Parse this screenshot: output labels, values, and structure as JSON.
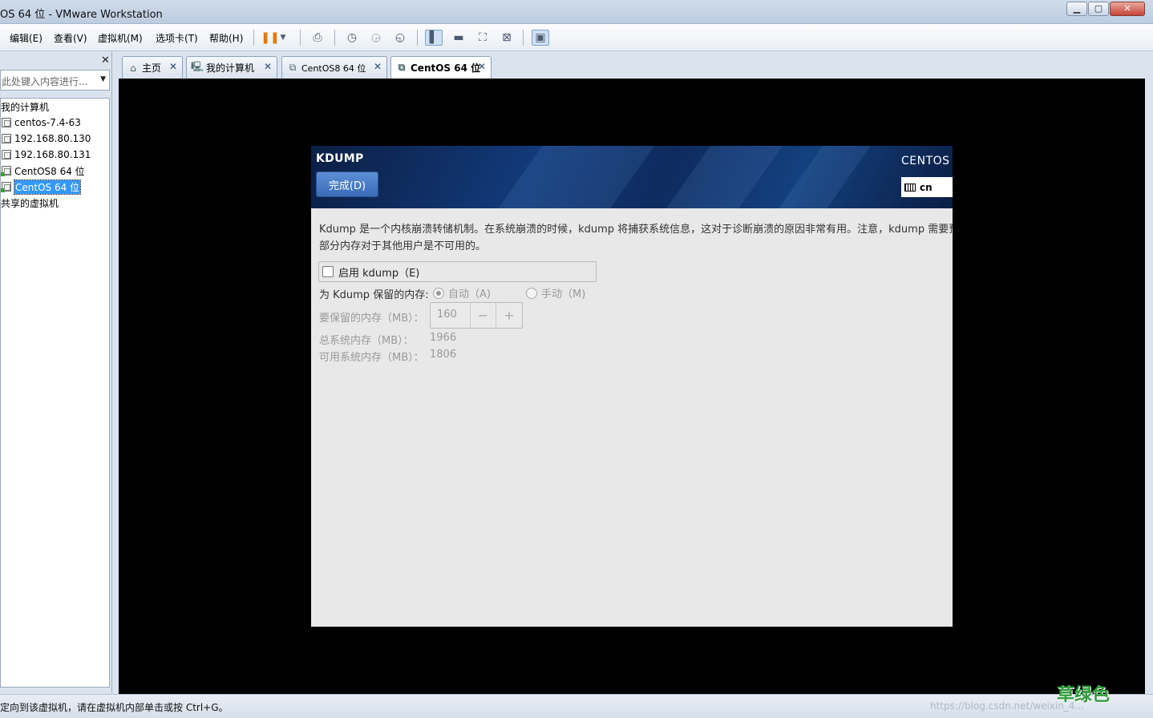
{
  "window": {
    "title": "OS 64 位 - VMware Workstation",
    "minimize": "▁",
    "maximize": "▢",
    "close": "✕"
  },
  "menu": {
    "items": [
      "编辑(E)",
      "查看(V)",
      "虚拟机(M)",
      "选项卡(T)",
      "帮助(H)"
    ]
  },
  "library": {
    "close": "✕",
    "search_placeholder": "此处键入内容进行...",
    "search_arrow": "▼",
    "root_label": "我的计算机",
    "vms": [
      "centos-7.4-63",
      "192.168.80.130",
      "192.168.80.131",
      "CentOS8 64 位",
      "CentOS 64 位"
    ],
    "selected_vm": "CentOS 64 位",
    "shared_label": "共享的虚拟机"
  },
  "tabs": [
    {
      "label": "主页",
      "icon": "home-icon"
    },
    {
      "label": "我的计算机",
      "icon": "computer-icon"
    },
    {
      "label": "CentOS8 64 位",
      "icon": "vm-icon"
    },
    {
      "label": "CentOS 64 位",
      "icon": "vm-icon",
      "active": true
    }
  ],
  "installer": {
    "spoke_title": "KDUMP",
    "done_button": "完成(D)",
    "product": "CENTOS",
    "keyboard": "cn",
    "description_line1": "Kdump 是一个内核崩溃转储机制。在系统崩溃的时候，kdump 将捕获系统信息，这对于诊断崩溃的原因非常有用。注意，kdump 需要预留",
    "description_line2": "部分内存对于其他用户是不可用的。",
    "enable_label": "启用 kdump（E)",
    "enabled": false,
    "reserve_label": "为 Kdump 保留的内存:",
    "radio_auto": "自动（A)",
    "radio_manual": "手动（M)",
    "selected_mode": "自动（A)",
    "memory_label": "要保留的内存（MB）：",
    "memory_value": "160",
    "minus": "−",
    "plus": "+",
    "total_label": "总系统内存（MB）：",
    "total_value": "1966",
    "usable_label": "可用系统内存（MB）：",
    "usable_value": "1806"
  },
  "status": {
    "text": "定向到该虚拟机，请在虚拟机内部单击或按 Ctrl+G。",
    "watermark": "https://blog.csdn.net/weixin_4...",
    "logo": "草绿色"
  },
  "colors": {
    "header_blue": "#123a7a",
    "done_button": "#3a6bb8",
    "selection": "#3399ff",
    "console_bg": "#000000"
  }
}
